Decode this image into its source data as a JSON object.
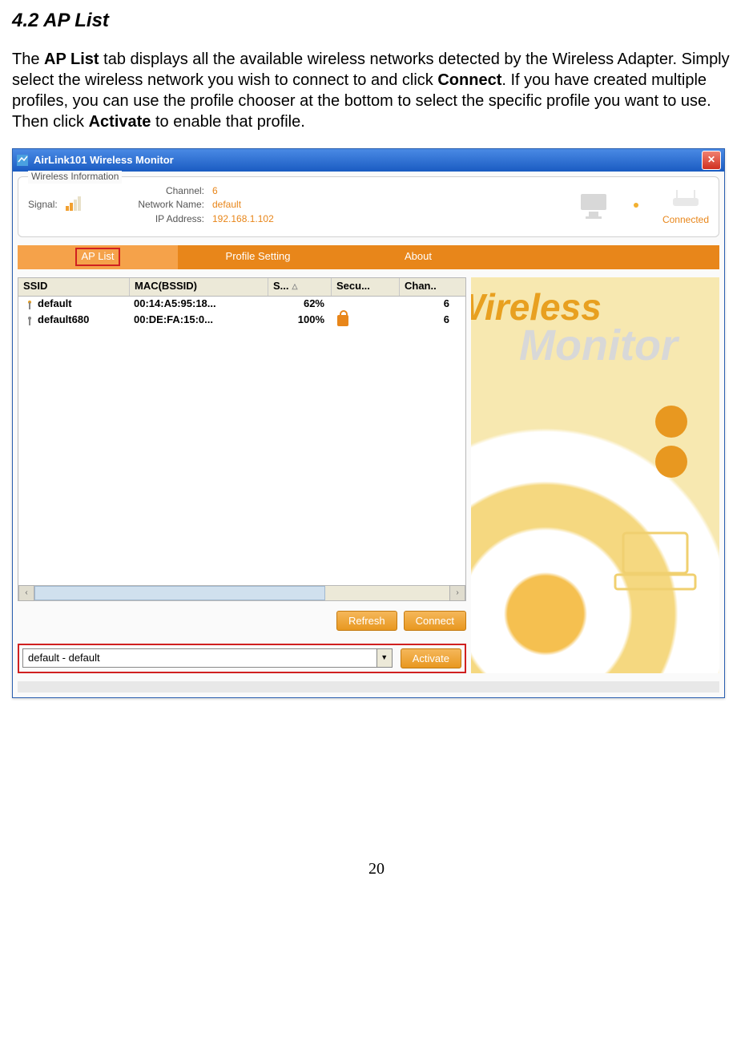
{
  "page": {
    "section_title": "4.2 AP List",
    "para_prefix": "The ",
    "para_bold1": "AP List",
    "para_mid1": " tab displays all the available wireless networks detected by the Wireless Adapter.  Simply select the wireless network you wish to connect to and click ",
    "para_bold2": "Connect",
    "para_mid2": ". If you have created multiple profiles, you can use the profile chooser at the bottom to select the specific profile you want to use.  Then click ",
    "para_bold3": "Activate",
    "para_mid3": " to enable that profile.",
    "page_number": "20"
  },
  "window": {
    "title": "AirLink101 Wireless Monitor",
    "close": "✕",
    "legend": "Wireless Information",
    "signal_label": "Signal:",
    "channel_label": "Channel:",
    "network_name_label": "Network Name:",
    "ip_label": "IP Address:",
    "channel_value": "6",
    "network_name_value": "default",
    "ip_value": "192.168.1.102",
    "status": "Connected"
  },
  "tabs": {
    "t1": "AP List",
    "t2": "Profile Setting",
    "t3": "About"
  },
  "table": {
    "headers": {
      "ssid": "SSID",
      "mac": "MAC(BSSID)",
      "signal": "S...",
      "security": "Secu...",
      "channel": "Chan.."
    },
    "rows": [
      {
        "ssid": "default",
        "mac": "00:14:A5:95:18...",
        "signal": "62%",
        "secured": false,
        "channel": "6"
      },
      {
        "ssid": "default680",
        "mac": "00:DE:FA:15:0...",
        "signal": "100%",
        "secured": true,
        "channel": "6"
      }
    ]
  },
  "buttons": {
    "refresh": "Refresh",
    "connect": "Connect",
    "activate": "Activate"
  },
  "profile": {
    "selected": "default - default"
  },
  "brand": {
    "line1": "Wireless",
    "line2": "Monitor"
  },
  "scroll": {
    "left": "‹",
    "right": "›"
  },
  "sort_indicator": "△"
}
